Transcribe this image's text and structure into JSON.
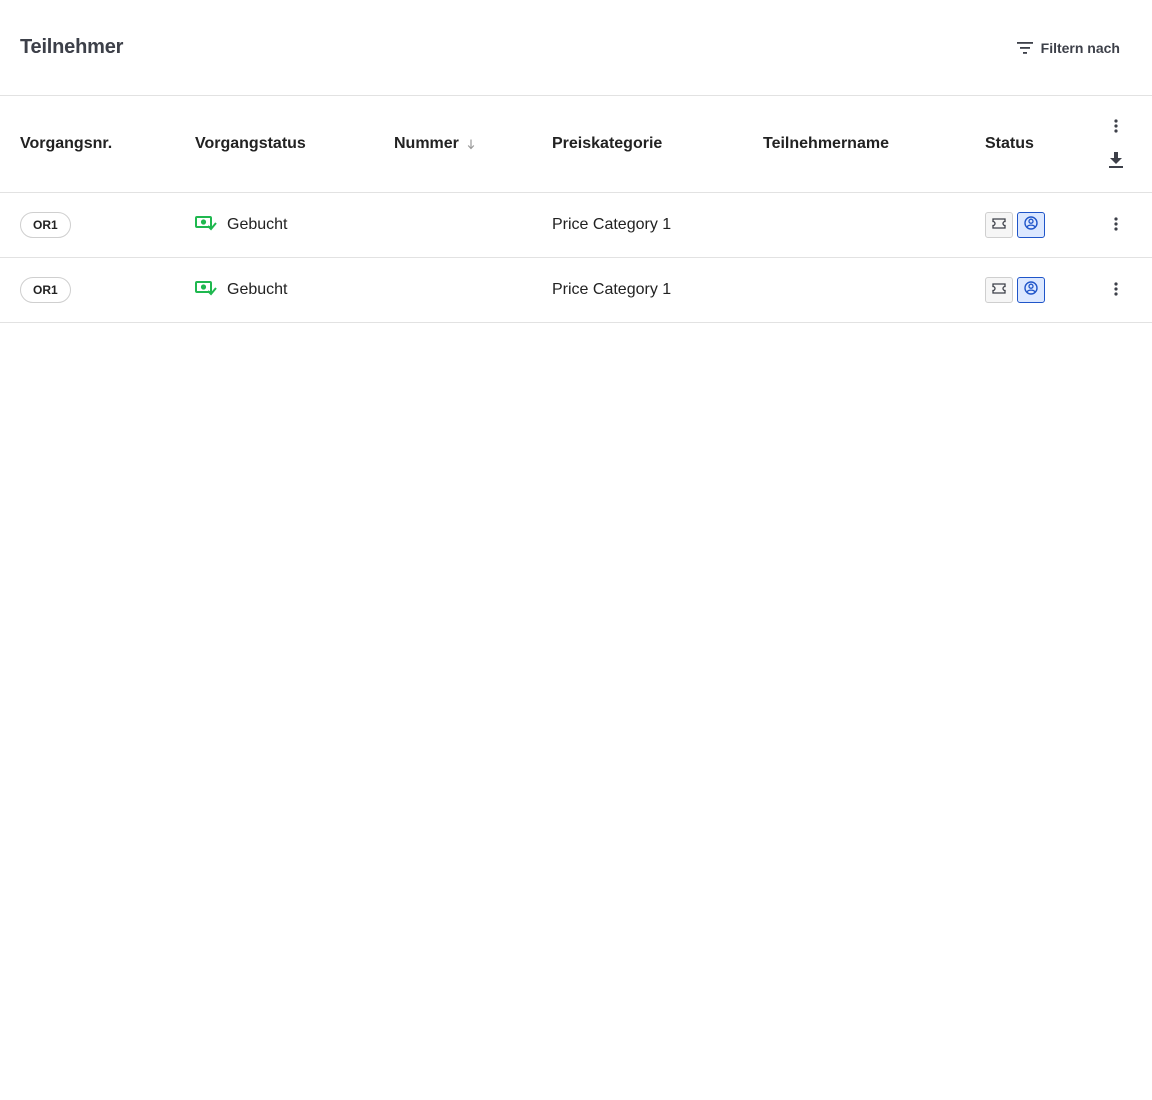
{
  "header": {
    "title": "Teilnehmer",
    "filter_label": "Filtern nach"
  },
  "table": {
    "columns": {
      "order_no": "Vorgangsnr.",
      "order_status": "Vorgangstatus",
      "number": "Nummer",
      "price_category": "Preiskategorie",
      "participant_name": "Teilnehmername",
      "status": "Status"
    },
    "sort": {
      "column": "number",
      "direction": "descending"
    },
    "rows": [
      {
        "order_no": "OR1",
        "order_status": "Gebucht",
        "number": "",
        "price_category": "Price Category 1",
        "participant_name": "",
        "status_icons": [
          "ticket-icon",
          "checkin-icon"
        ]
      },
      {
        "order_no": "OR1",
        "order_status": "Gebucht",
        "number": "",
        "price_category": "Price Category 1",
        "participant_name": "",
        "status_icons": [
          "ticket-icon",
          "checkin-icon"
        ]
      }
    ]
  },
  "colors": {
    "booked_green": "#1fb84f",
    "active_blue": "#1f55c9",
    "active_blue_bg": "#dce8ff"
  }
}
